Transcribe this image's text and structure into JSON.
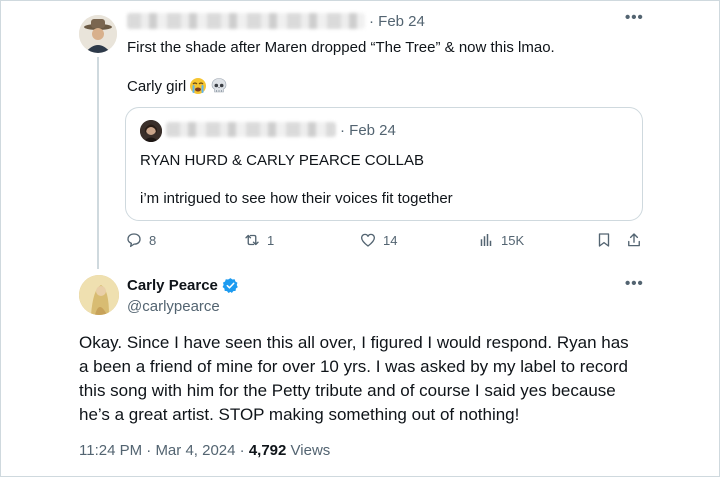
{
  "reply_tweet": {
    "date": "Feb 24",
    "more_label": "•••",
    "text_line1": "First the shade after Maren dropped “The Tree” & now this lmao.",
    "text_line2": "Carly girl",
    "emojis": [
      "crying-face-icon",
      "skull-icon"
    ]
  },
  "quoted_tweet": {
    "date": "Feb 24",
    "text_line1": "RYAN HURD & CARLY PEARCE COLLAB",
    "text_line2": "i’m intrigued to see how their voices fit together"
  },
  "actions": {
    "replies": "8",
    "reposts": "1",
    "likes": "14",
    "views": "15K"
  },
  "main_tweet": {
    "author_name": "Carly Pearce",
    "handle": "@carlypearce",
    "more_label": "•••",
    "body_lines": [
      "Okay. Since I have seen this all over, I figured I would respond. Ryan has",
      "a been a friend of mine for over 10 yrs. I was asked by my label to record",
      "this song with him for the Petty tribute and of course I said yes because",
      "he’s a great artist. STOP making something out of nothing!"
    ],
    "time": "11:24 PM",
    "date": "Mar 4, 2024",
    "separator": "·",
    "views_count": "4,792",
    "views_label": "Views"
  },
  "colors": {
    "text": "#0f1419",
    "secondary": "#536471",
    "border": "#cfd9de",
    "verified": "#1d9bf0"
  }
}
